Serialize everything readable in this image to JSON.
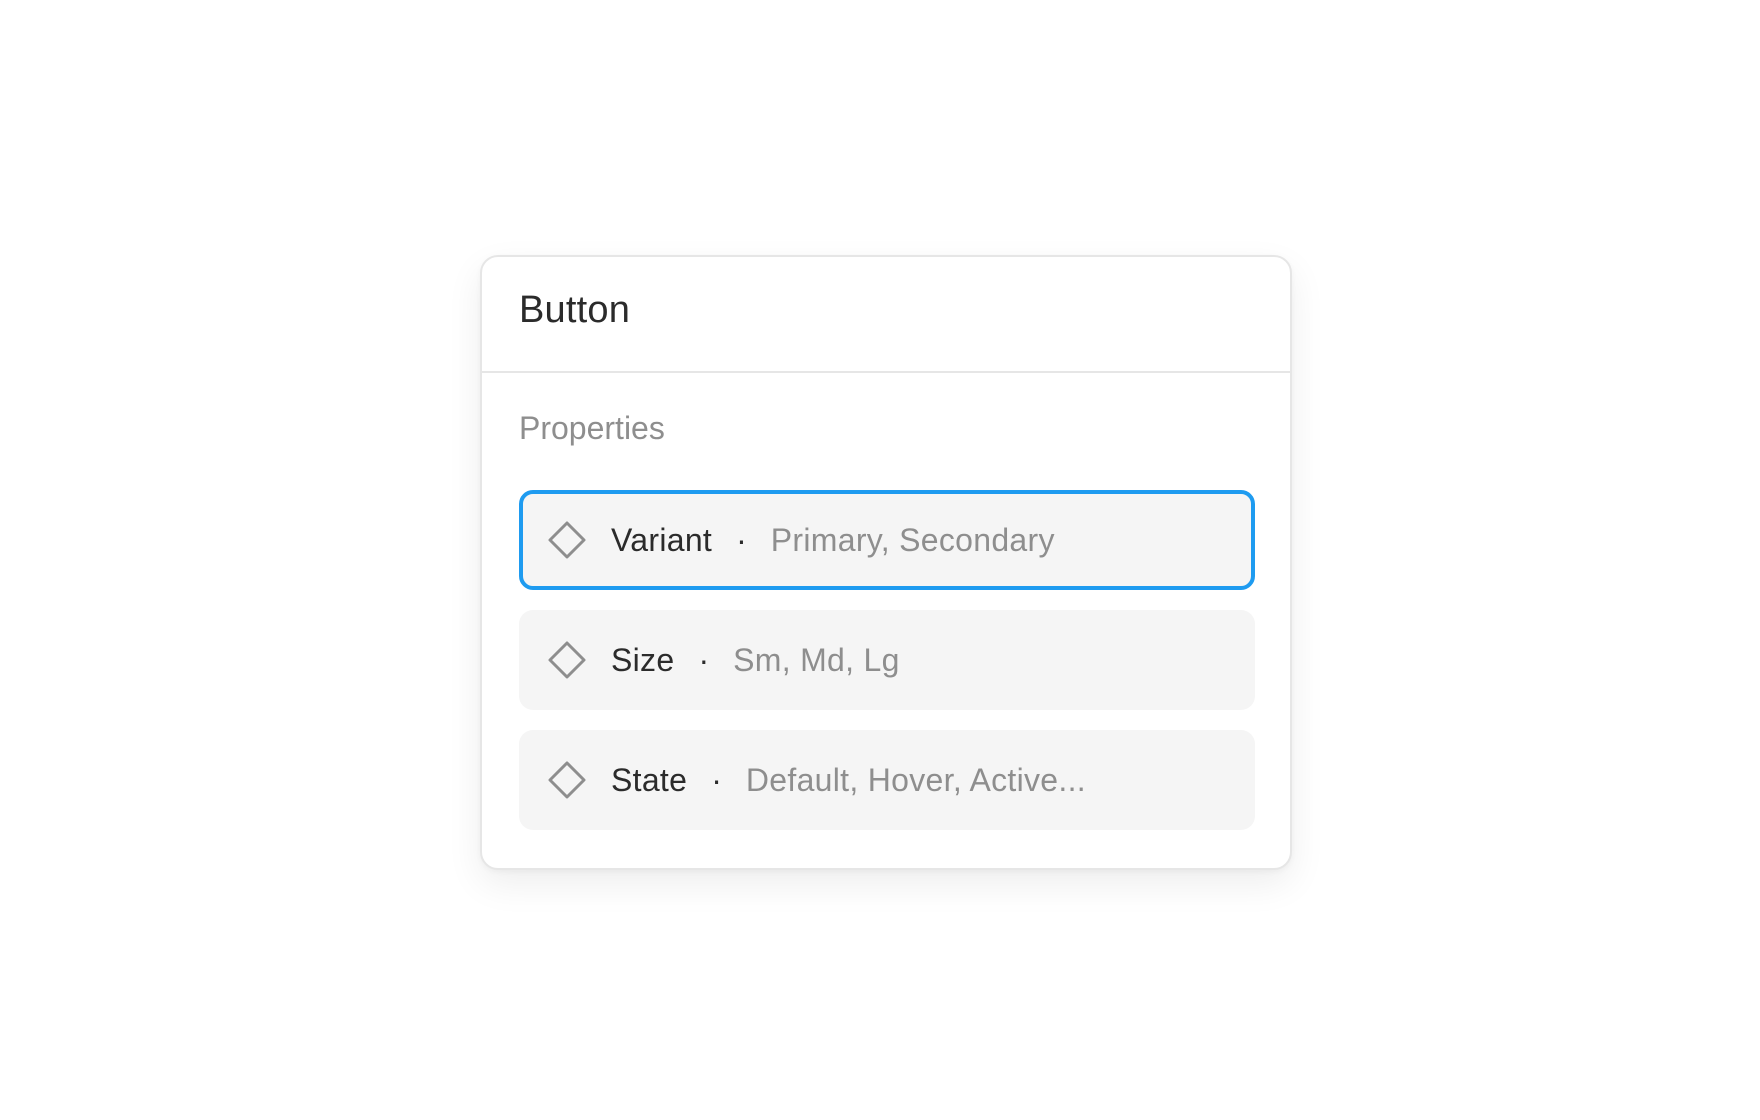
{
  "panel": {
    "title": "Button",
    "section_label": "Properties",
    "separator": "·",
    "properties": [
      {
        "name": "Variant",
        "values": "Primary, Secondary",
        "selected": true
      },
      {
        "name": "Size",
        "values": "Sm, Md, Lg",
        "selected": false
      },
      {
        "name": "State",
        "values": "Default, Hover, Active...",
        "selected": false
      }
    ]
  },
  "icons": {
    "property": "diamond-icon"
  },
  "colors": {
    "selected_border": "#1e9bf0",
    "row_background": "#f5f5f5",
    "primary_text": "#2b2b2b",
    "secondary_text": "#8e8e8e",
    "divider": "#e6e6e6"
  }
}
